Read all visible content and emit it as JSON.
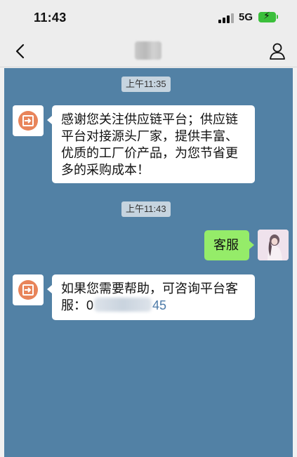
{
  "status_bar": {
    "time": "11:43",
    "network": "5G"
  },
  "nav": {
    "title": ""
  },
  "messages": [
    {
      "type": "time",
      "text": "上午11:35"
    },
    {
      "type": "in",
      "lines": [
        "感谢您关注供应链平台；供应链",
        "平台对接源头厂家，提供丰富、",
        "优质的工厂价产品，为您节省更",
        "多的采购成本！"
      ]
    },
    {
      "type": "time",
      "text": "上午11:43"
    },
    {
      "type": "out",
      "text": "客服"
    },
    {
      "type": "in",
      "lines": [
        "如果您需要帮助，可咨询平台客"
      ],
      "phone_prefix": "服：0",
      "phone_suffix": "45"
    }
  ],
  "colors": {
    "chat_background": "#5281a5",
    "incoming_bubble": "#ffffff",
    "outgoing_bubble": "#95ec69",
    "bot_avatar": "#e8845a",
    "battery": "#3bbf3b"
  },
  "icons": {
    "back": "chevron-left-icon",
    "profile": "person-icon",
    "bot_avatar": "login-arrow-icon"
  }
}
